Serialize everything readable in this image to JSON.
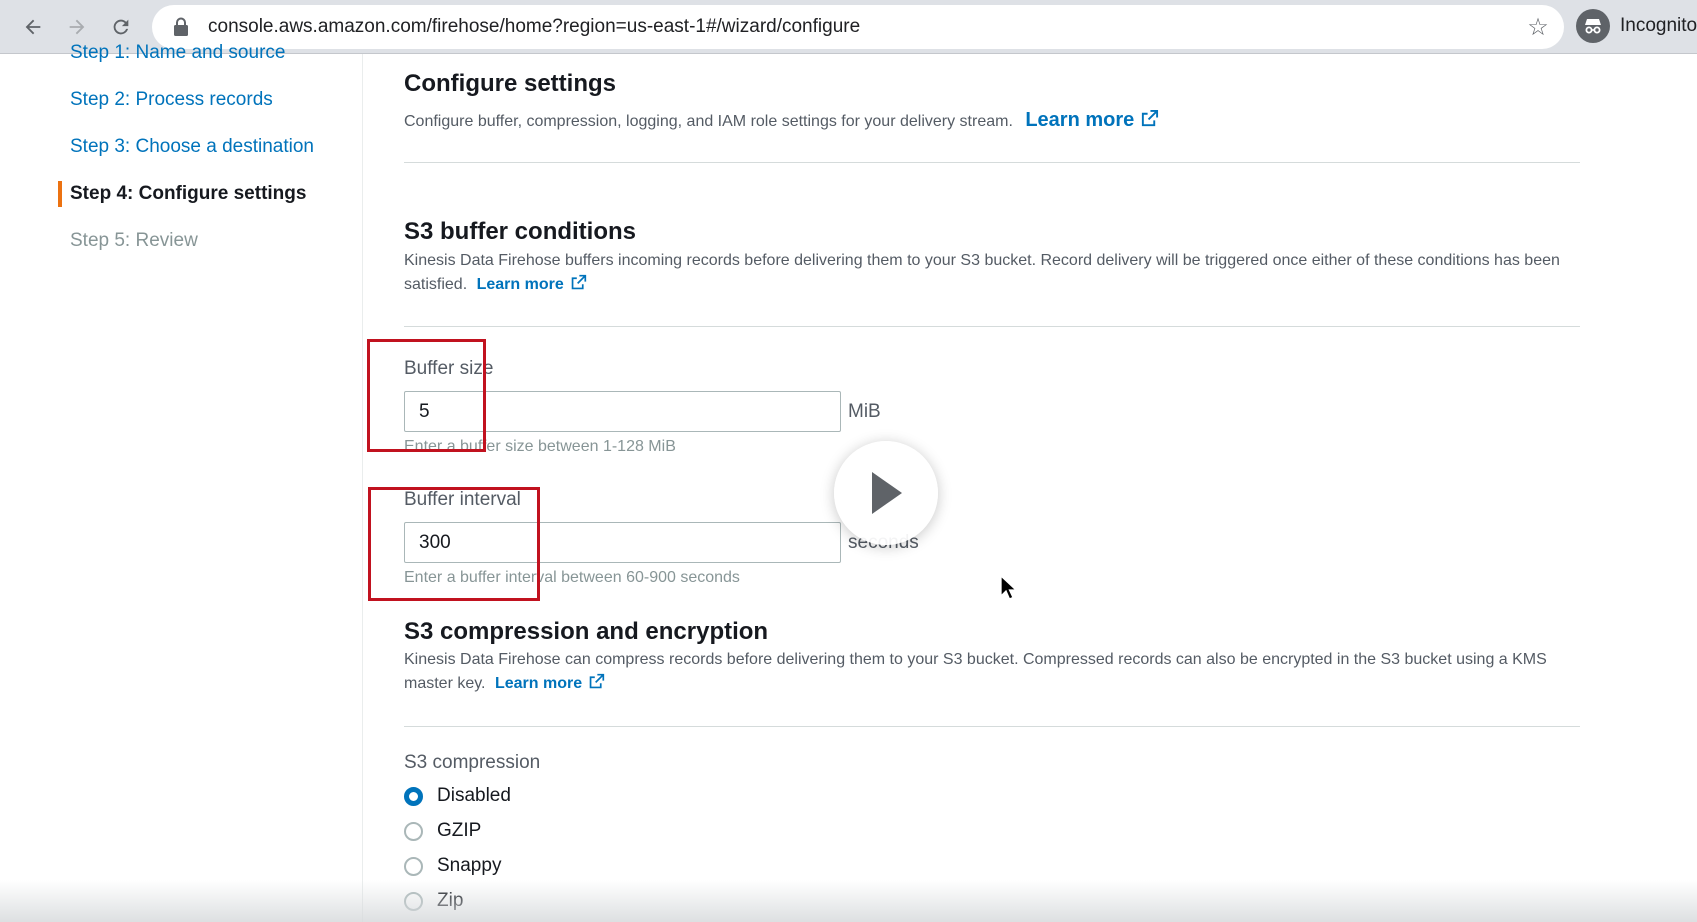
{
  "browser": {
    "url": "console.aws.amazon.com/firehose/home?region=us-east-1#/wizard/configure",
    "profile_label": "Incognito"
  },
  "wizard_nav": {
    "steps": [
      {
        "label": "Step 1: Name and source",
        "state": "completed"
      },
      {
        "label": "Step 2: Process records",
        "state": "completed"
      },
      {
        "label": "Step 3: Choose a destination",
        "state": "completed"
      },
      {
        "label": "Step 4: Configure settings",
        "state": "current"
      },
      {
        "label": "Step 5: Review",
        "state": "upcoming"
      }
    ]
  },
  "configure": {
    "title": "Configure settings",
    "description": "Configure buffer, compression, logging, and IAM role settings for your delivery stream.",
    "learn_more": "Learn more"
  },
  "buffer": {
    "title": "S3 buffer conditions",
    "description": "Kinesis Data Firehose buffers incoming records before delivering them to your S3 bucket. Record delivery will be triggered once either of these conditions has been satisfied.",
    "learn_more": "Learn more",
    "size": {
      "label": "Buffer size",
      "value": "5",
      "unit": "MiB",
      "hint": "Enter a buffer size between 1-128 MiB"
    },
    "interval": {
      "label": "Buffer interval",
      "value": "300",
      "unit": "seconds",
      "hint": "Enter a buffer interval between 60-900 seconds"
    }
  },
  "compression": {
    "title": "S3 compression and encryption",
    "description": "Kinesis Data Firehose can compress records before delivering them to your S3 bucket. Compressed records can also be encrypted in the S3 bucket using a KMS master key.",
    "learn_more": "Learn more",
    "field_label": "S3 compression",
    "options": [
      "Disabled",
      "GZIP",
      "Snappy",
      "Zip"
    ],
    "selected": "Disabled"
  },
  "colors": {
    "link": "#0073bb",
    "accent_step": "#ec7211",
    "highlight_box": "#c1121f"
  }
}
